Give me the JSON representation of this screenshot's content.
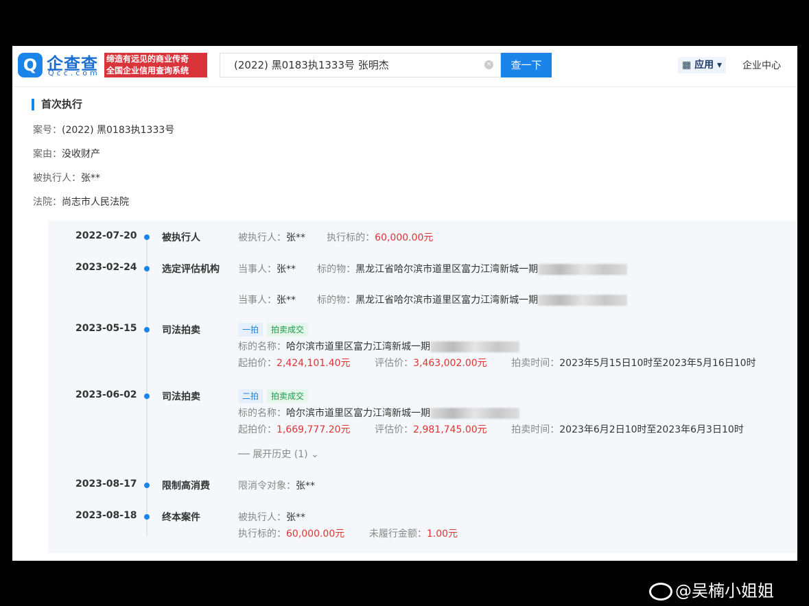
{
  "header": {
    "brand": "企查查",
    "brand_sub": "Qcc.com",
    "slogan_line1": "缔造有远见的商业传奇",
    "slogan_line2": "全国企业信用查询系统",
    "search_value": "(2022) 黑0183执1333号 张明杰",
    "search_button": "查一下",
    "apps": "应用",
    "enterprise_center": "企业中心"
  },
  "section": {
    "title": "首次执行",
    "case_no_label": "案号：",
    "case_no": "(2022) 黑0183执1333号",
    "cause_label": "案由：",
    "cause": "没收财产",
    "executed_label": "被执行人：",
    "executed": "张**",
    "court_label": "法院：",
    "court": "尚志市人民法院"
  },
  "timeline": [
    {
      "date": "2022-07-20",
      "event": "被执行人",
      "l1": "被执行人：",
      "v1": "张**",
      "l2": "执行标的：",
      "v2": "60,000.00元"
    },
    {
      "date": "2023-02-24",
      "event": "选定评估机构",
      "l1": "当事人：",
      "v1": "张**",
      "l2": "标的物：",
      "v2": "黑龙江省哈尔滨市道里区富力江湾新城一期",
      "l3": "当事人：",
      "v3": "张**",
      "l4": "标的物：",
      "v4": "黑龙江省哈尔滨市道里区富力江湾新城一期"
    },
    {
      "date": "2023-05-15",
      "event": "司法拍卖",
      "tag1": "一拍",
      "tag2": "拍卖成交",
      "name_label": "标的名称：",
      "name": "哈尔滨市道里区富力江湾新城一期",
      "start_label": "起拍价：",
      "start": "2,424,101.40元",
      "eval_label": "评估价：",
      "eval": "3,463,002.00元",
      "time_label": "拍卖时间：",
      "time": "2023年5月15日10时至2023年5月16日10时"
    },
    {
      "date": "2023-06-02",
      "event": "司法拍卖",
      "tag1": "二拍",
      "tag2": "拍卖成交",
      "name_label": "标的名称：",
      "name": "哈尔滨市道里区富力江湾新城一期",
      "start_label": "起拍价：",
      "start": "1,669,777.20元",
      "eval_label": "评估价：",
      "eval": "2,981,745.00元",
      "time_label": "拍卖时间：",
      "time": "2023年6月2日10时至2023年6月3日10时",
      "history": "展开历史 (1)"
    },
    {
      "date": "2023-08-17",
      "event": "限制高消费",
      "l1": "限消令对象：",
      "v1": "张**"
    },
    {
      "date": "2023-08-18",
      "event": "终本案件",
      "l1": "被执行人：",
      "v1": "张**",
      "l2": "执行标的：",
      "v2": "60,000.00元",
      "l3": "未履行金额：",
      "v3": "1.00元"
    }
  ],
  "watermark": "@吴楠小姐姐"
}
